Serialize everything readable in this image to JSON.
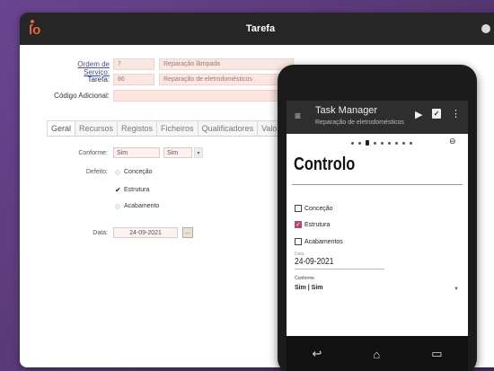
{
  "window": {
    "title": "Tarefa",
    "app_icon": "app-logo-icon"
  },
  "form": {
    "ordem_label": "Ordem de Serviço:",
    "ordem_num": "7",
    "ordem_desc": "Reparação lâmpada",
    "tarefa_label": "Tarefa:",
    "tarefa_num": "86",
    "tarefa_desc": "Reparação de eletrodomésticos",
    "codigo_label": "Código Adicional:"
  },
  "tabs": [
    "Geral",
    "Recursos",
    "Registos",
    "Ficheiros",
    "Qualificadores",
    "Valori"
  ],
  "panel": {
    "conforme_label": "Conforme:",
    "conforme_value": "Sim",
    "conforme_select": "Sim",
    "defeito_label": "Defeito:",
    "options": [
      {
        "label": "Conceção",
        "checked": false
      },
      {
        "label": "Estrutura",
        "checked": true
      },
      {
        "label": "Acabamento",
        "checked": false
      }
    ],
    "data_label": "Data:",
    "data_value": "24-09-2021",
    "date_button": "..."
  },
  "phone": {
    "app_title": "Task Manager",
    "app_subtitle": "Reparação de eletrodomésticos",
    "heading": "Controlo",
    "checkboxes": [
      {
        "label": "Conceção",
        "checked": false
      },
      {
        "label": "Estrutura",
        "checked": true
      },
      {
        "label": "Acabamentos",
        "checked": false
      }
    ],
    "data_caption": "Data",
    "date": "24-09-2021",
    "conforme_caption": "Conforme",
    "conforme_value": "Sim | Sim",
    "pager_count": 9,
    "pager_current": 3
  },
  "colors": {
    "background": "#5c3a7e",
    "titlebar": "#262626",
    "field_bg": "#fbe7e2",
    "checkbox_accent": "#b6467c"
  }
}
